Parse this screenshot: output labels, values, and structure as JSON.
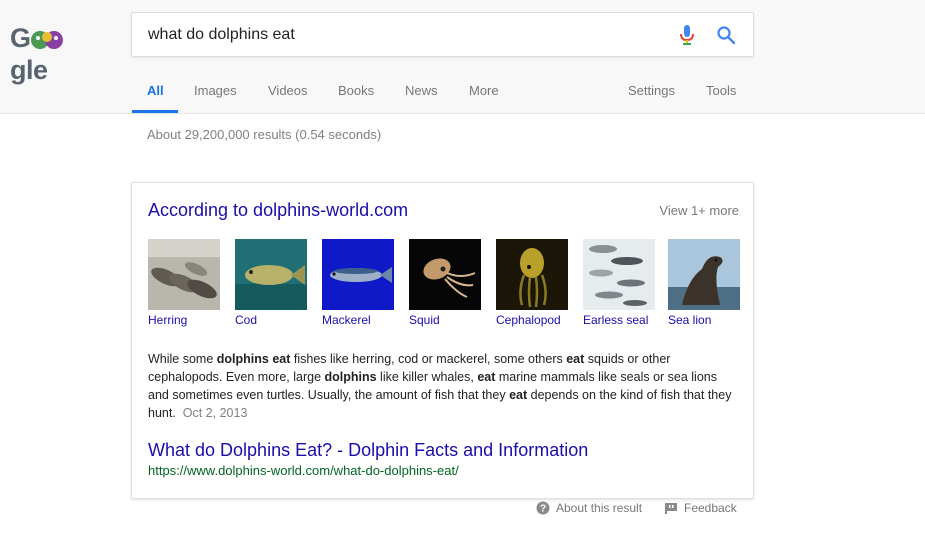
{
  "logo": {
    "left": "G",
    "right": "gle"
  },
  "search": {
    "query": "what do dolphins eat",
    "placeholder": "",
    "mic_icon": "microphone-icon",
    "search_icon": "magnifier-icon"
  },
  "tabs": [
    {
      "label": "All"
    },
    {
      "label": "Images"
    },
    {
      "label": "Videos"
    },
    {
      "label": "Books"
    },
    {
      "label": "News"
    },
    {
      "label": "More"
    }
  ],
  "right_tabs": [
    {
      "label": "Settings"
    },
    {
      "label": "Tools"
    }
  ],
  "result_stats": "About 29,200,000 results (0.54 seconds)",
  "featured": {
    "title": "According to dolphins-world.com",
    "view_more": "View 1+ more",
    "items": [
      {
        "label": "Herring"
      },
      {
        "label": "Cod"
      },
      {
        "label": "Mackerel"
      },
      {
        "label": "Squid"
      },
      {
        "label": "Cephalopod"
      },
      {
        "label": "Earless seal"
      },
      {
        "label": "Sea lion"
      }
    ],
    "snippet": {
      "s1": "While some ",
      "b1": "dolphins eat",
      "s2": " fishes like herring, cod or mackerel, some others ",
      "b2": "eat",
      "s3": " squids or other cephalopods. Even more, large ",
      "b3": "dolphins",
      "s4": " like killer whales, ",
      "b4": "eat",
      "s5": " marine mammals like seals or sea lions and sometimes even turtles. Usually, the amount of fish that they ",
      "b5": "eat",
      "s6": " depends on the kind of fish that they hunt.",
      "date": "Oct 2, 2013"
    },
    "link_title": "What do Dolphins Eat? - Dolphin Facts and Information",
    "link_url": "https://www.dolphins-world.com/what-do-dolphins-eat/"
  },
  "footer": {
    "about": "About this result",
    "feedback": "Feedback"
  },
  "colors": {
    "link": "#1a0dab",
    "url": "#006621",
    "accent": "#1a73e8"
  }
}
